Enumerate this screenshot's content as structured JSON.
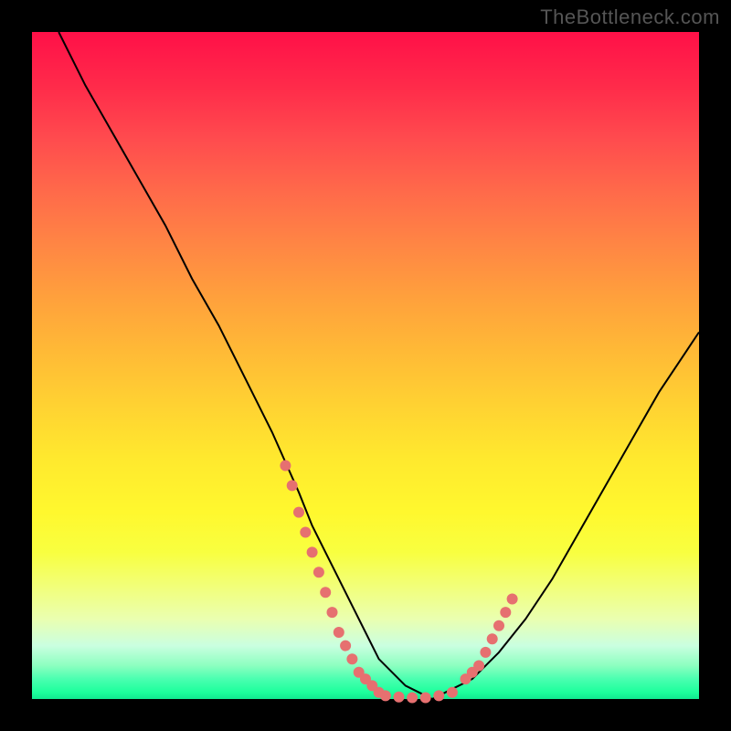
{
  "watermark": "TheBottleneck.com",
  "chart_data": {
    "type": "line",
    "title": "",
    "xlabel": "",
    "ylabel": "",
    "xlim": [
      0,
      100
    ],
    "ylim": [
      0,
      100
    ],
    "series": [
      {
        "name": "main-curve",
        "x": [
          4,
          8,
          12,
          16,
          20,
          24,
          28,
          32,
          36,
          40,
          42,
          44,
          46,
          48,
          50,
          52,
          54,
          56,
          58,
          60,
          62,
          66,
          70,
          74,
          78,
          82,
          86,
          90,
          94,
          98,
          100
        ],
        "y": [
          100,
          92,
          85,
          78,
          71,
          63,
          56,
          48,
          40,
          31,
          26,
          22,
          18,
          14,
          10,
          6,
          4,
          2,
          1,
          0,
          1,
          3,
          7,
          12,
          18,
          25,
          32,
          39,
          46,
          52,
          55
        ]
      },
      {
        "name": "dotted-left",
        "x": [
          38,
          39,
          40,
          41,
          42,
          43,
          44,
          45,
          46,
          47,
          48,
          49,
          50,
          51,
          52
        ],
        "y": [
          35,
          32,
          28,
          25,
          22,
          19,
          16,
          13,
          10,
          8,
          6,
          4,
          3,
          2,
          1
        ]
      },
      {
        "name": "dotted-bottom",
        "x": [
          53,
          55,
          57,
          59,
          61,
          63
        ],
        "y": [
          0.5,
          0.3,
          0.2,
          0.2,
          0.5,
          1
        ]
      },
      {
        "name": "dotted-right",
        "x": [
          65,
          66,
          67,
          68,
          69,
          70,
          71,
          72
        ],
        "y": [
          3,
          4,
          5,
          7,
          9,
          11,
          13,
          15
        ]
      }
    ],
    "dot_color": "#e67070",
    "curve_color": "#000000"
  }
}
